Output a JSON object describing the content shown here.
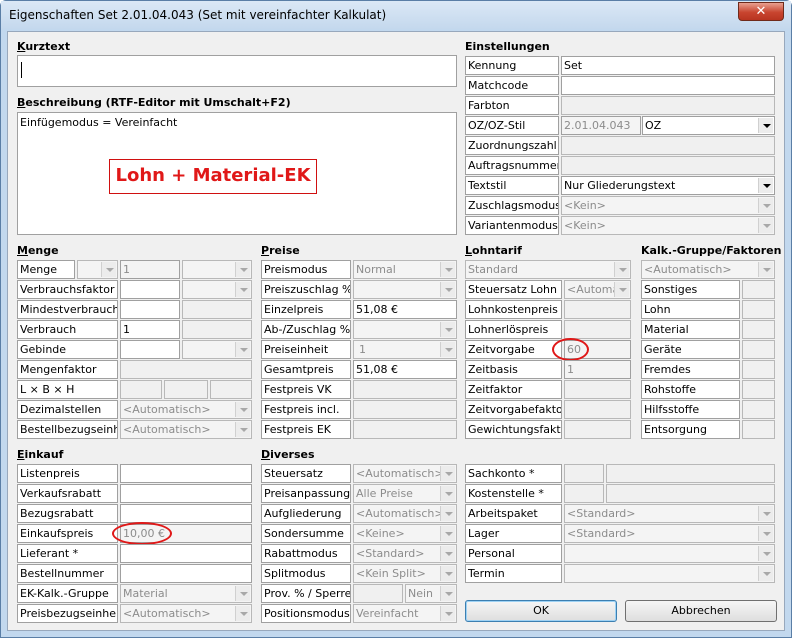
{
  "window": {
    "title": "Eigenschaften Set 2.01.04.043 (Set mit vereinfachter Kalkulat)",
    "close_glyph": "✕"
  },
  "kurztext": {
    "heading_u": "K",
    "heading_rest": "urztext",
    "value": ""
  },
  "beschreibung": {
    "heading_u": "B",
    "heading_rest": "eschreibung (RTF-Editor mit Umschalt+F2)",
    "text": "Einfügemodus = Vereinfacht",
    "highlight": "Lohn + Material-EK"
  },
  "einstellungen": {
    "heading": "Einstellungen",
    "kennung_label": "Kennung",
    "kennung_value": "Set",
    "matchcode_label": "Matchcode",
    "farbton_label": "Farbton",
    "ozstil_label": "OZ/OZ-Stil",
    "ozstil_value": "2.01.04.043",
    "ozstil_select": "OZ",
    "zuordnungszahl_label": "Zuordnungszahl",
    "auftragsnummer_label": "Auftragsnummer",
    "textstil_label": "Textstil",
    "textstil_value": "Nur Gliederungstext",
    "zuschlagsmodus_label": "Zuschlagsmodus",
    "zuschlagsmodus_value": "<Kein>",
    "variantenmodus_label": "Variantenmodus",
    "variantenmodus_value": "<Kein>"
  },
  "menge": {
    "heading_u": "M",
    "heading_rest": "enge",
    "menge_label": "Menge",
    "menge_value": "1",
    "verbrauchsfaktor_label": "Verbrauchsfaktor",
    "mindestverbrauch_label": "Mindestverbrauch",
    "verbrauch_label": "Verbrauch",
    "verbrauch_value": "1",
    "gebinde_label": "Gebinde",
    "mengenfaktor_label": "Mengenfaktor",
    "lbh_label": "L × B × H",
    "dezimalstellen_label": "Dezimalstellen",
    "dezimalstellen_value": "<Automatisch>",
    "bestellbezug_label": "Bestellbezugseinheit",
    "bestellbezug_value": "<Automatisch>"
  },
  "preise": {
    "heading_u": "P",
    "heading_rest": "reise",
    "preismodus_label": "Preismodus",
    "preismodus_value": "Normal",
    "preiszuschlag_label": "Preiszuschlag %",
    "einzelpreis_label": "Einzelpreis",
    "einzelpreis_value": "51,08 €",
    "abzuschlag_label": "Ab-/Zuschlag %",
    "preiseinheit_label": "Preiseinheit",
    "preiseinheit_value": "1",
    "gesamtpreis_label": "Gesamtpreis",
    "gesamtpreis_value": "51,08 €",
    "festpreisvk_label": "Festpreis VK",
    "festpreisincl_label": "Festpreis incl.",
    "festpreisek_label": "Festpreis EK"
  },
  "lohntarif": {
    "heading_u": "L",
    "heading_rest": "ohntarif",
    "tarif_value": "Standard",
    "steuersatzlohn_label": "Steuersatz Lohn",
    "steuersatzlohn_value": "<Automat",
    "lohnkostenpreis_label": "Lohnkostenpreis",
    "lohnerloespreis_label": "Lohnerlöspreis",
    "zeitvorgabe_label": "Zeitvorgabe",
    "zeitvorgabe_value": "60",
    "zeitbasis_label": "Zeitbasis",
    "zeitbasis_value": "1",
    "zeitfaktor_label": "Zeitfaktor",
    "zeitvorgabefaktor_label": "Zeitvorgabefaktor",
    "gewichtungsfaktor_label": "Gewichtungsfaktor"
  },
  "kalk": {
    "heading": "Kalk.-Gruppe/Faktoren",
    "gruppe_value": "<Automatisch>",
    "rows": [
      "Sonstiges",
      "Lohn",
      "Material",
      "Geräte",
      "Fremdes",
      "Rohstoffe",
      "Hilfsstoffe",
      "Entsorgung"
    ]
  },
  "einkauf": {
    "heading_u": "E",
    "heading_rest": "inkauf",
    "listenpreis_label": "Listenpreis",
    "verkaufsrabatt_label": "Verkaufsrabatt",
    "bezugsrabatt_label": "Bezugsrabatt",
    "einkaufspreis_label": "Einkaufspreis",
    "einkaufspreis_value": "10,00 €",
    "lieferant_label": "Lieferant *",
    "bestellnummer_label": "Bestellnummer",
    "ekgruppe_label": "EK-Kalk.-Gruppe",
    "ekgruppe_value": "Material",
    "preisbezug_label": "Preisbezugseinheit",
    "preisbezug_value": "<Automatisch>"
  },
  "diverses": {
    "heading_u": "D",
    "heading_rest": "iverses",
    "steuersatz_label": "Steuersatz",
    "steuersatz_value": "<Automatisch>",
    "preisanpassung_label": "Preisanpassung",
    "preisanpassung_value": "Alle Preise",
    "aufgliederung_label": "Aufgliederung",
    "aufgliederung_value": "<Automatisch>",
    "sondersumme_label": "Sondersumme",
    "sondersumme_value": "<Keine>",
    "rabattmodus_label": "Rabattmodus",
    "rabattmodus_value": "<Standard>",
    "splitmodus_label": "Splitmodus",
    "splitmodus_value": "<Kein Split>",
    "prov_label": "Prov. % / Sperre",
    "prov_value": "Nein",
    "positionsmodus_label": "Positionsmodus",
    "positionsmodus_value": "Vereinfacht"
  },
  "right_bottom": {
    "sachkonto_label": "Sachkonto *",
    "kostenstelle_label": "Kostenstelle *",
    "arbeitspaket_label": "Arbeitspaket",
    "arbeitspaket_value": "<Standard>",
    "lager_label": "Lager",
    "lager_value": "<Standard>",
    "personal_label": "Personal",
    "termin_label": "Termin"
  },
  "buttons": {
    "ok": "OK",
    "abbrechen": "Abbrechen"
  }
}
